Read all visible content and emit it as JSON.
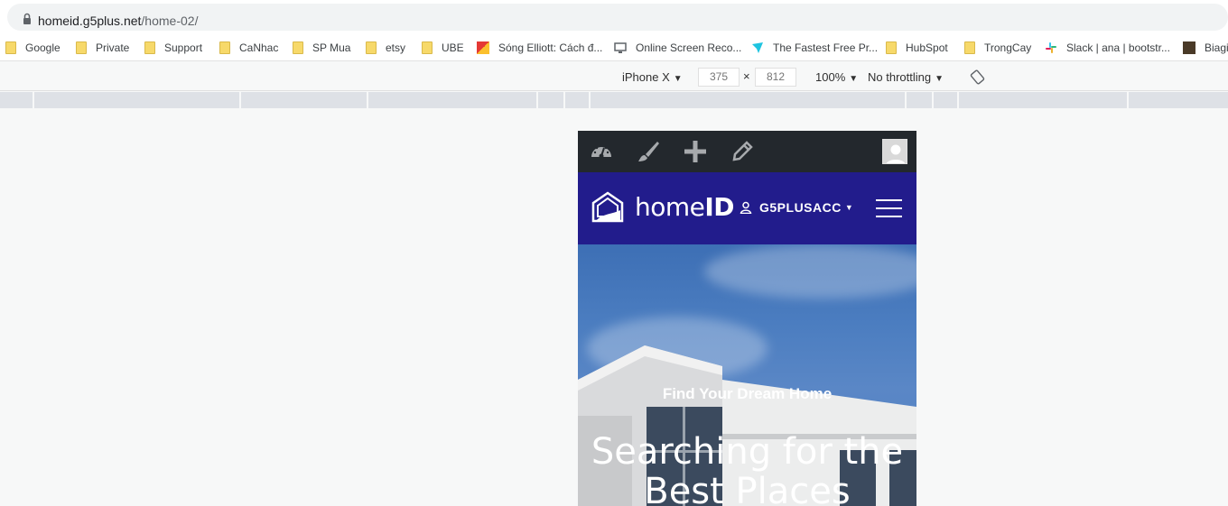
{
  "browser": {
    "url_host": "homeid.g5plus.net",
    "url_path": "/home-02/"
  },
  "bookmarks": [
    {
      "label": "Google",
      "icon": "folder-icon"
    },
    {
      "label": "Private",
      "icon": "folder-icon"
    },
    {
      "label": "Support",
      "icon": "folder-icon"
    },
    {
      "label": "CaNhac",
      "icon": "folder-icon"
    },
    {
      "label": "SP Mua",
      "icon": "folder-icon"
    },
    {
      "label": "etsy",
      "icon": "folder-icon"
    },
    {
      "label": "UBE",
      "icon": "folder-icon"
    },
    {
      "label": "Sóng Elliott: Cách đ...",
      "icon": "site-icon"
    },
    {
      "label": "Online Screen Reco...",
      "icon": "monitor-icon"
    },
    {
      "label": "The Fastest Free Pr...",
      "icon": "send-icon"
    },
    {
      "label": "HubSpot",
      "icon": "folder-icon"
    },
    {
      "label": "TrongCay",
      "icon": "folder-icon"
    },
    {
      "label": "Slack | ana | bootstr...",
      "icon": "slack-icon"
    },
    {
      "label": "Biagi",
      "icon": "site-icon"
    }
  ],
  "device_toolbar": {
    "device": "iPhone X",
    "width": "375",
    "times": "×",
    "height": "812",
    "zoom": "100%",
    "throttling": "No throttling"
  },
  "site": {
    "brand_home": "home",
    "brand_id": "ID",
    "account": "G5PLUSACC",
    "hero_subtitle": "Find Your Dream Home",
    "hero_title": "Searching for the Best Places"
  },
  "colors": {
    "nav_bg": "#221c8c",
    "wp_bar_bg": "#23282d"
  }
}
